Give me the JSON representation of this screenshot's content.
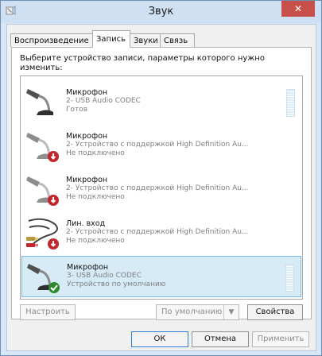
{
  "window": {
    "title": "Звук",
    "close_icon": "✕"
  },
  "tabs": [
    {
      "label": "Воспроизведение",
      "active": false
    },
    {
      "label": "Запись",
      "active": true
    },
    {
      "label": "Звуки",
      "active": false
    },
    {
      "label": "Связь",
      "active": false
    }
  ],
  "instruction": "Выберите устройство записи, параметры которого нужно изменить:",
  "devices": [
    {
      "name": "Микрофон",
      "description": "2- USB Audio CODEC",
      "status": "Готов",
      "icon": "microphone-icon",
      "badge": "none",
      "selected": false
    },
    {
      "name": "Микрофон",
      "description": "2- Устройство с поддержкой High Definition Au...",
      "status": "Не подключено",
      "icon": "microphone-icon",
      "badge": "disconnected-badge-icon",
      "selected": false
    },
    {
      "name": "Микрофон",
      "description": "2- Устройство с поддержкой High Definition Au...",
      "status": "Не подключено",
      "icon": "microphone-icon",
      "badge": "disconnected-badge-icon",
      "selected": false
    },
    {
      "name": "Лин. вход",
      "description": "2- Устройство с поддержкой High Definition Au...",
      "status": "Не подключено",
      "icon": "line-in-cable-icon",
      "badge": "disconnected-badge-icon",
      "selected": false
    },
    {
      "name": "Микрофон",
      "description": "3- USB Audio CODEC",
      "status": "Устройство по умолчанию",
      "icon": "microphone-icon",
      "badge": "default-check-icon",
      "selected": true
    }
  ],
  "buttons": {
    "configure": "Настроить",
    "set_default": "По умолчанию",
    "properties": "Свойства",
    "ok": "ОК",
    "cancel": "Отмена",
    "apply": "Применить"
  }
}
